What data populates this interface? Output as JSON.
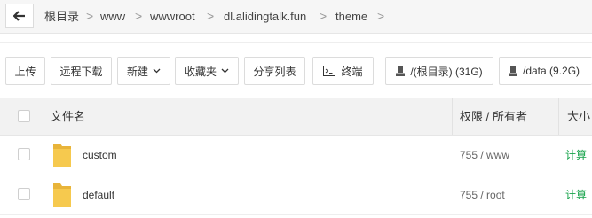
{
  "breadcrumb": {
    "items": [
      "根目录",
      "www",
      "wwwroot",
      "dl.alidingtalk.fun",
      "theme"
    ],
    "separator": ">"
  },
  "toolbar": {
    "upload": "上传",
    "remote_download": "远程下载",
    "new": "新建",
    "favorites": "收藏夹",
    "share_list": "分享列表",
    "terminal": "终端",
    "disk_root": "/(根目录) (31G)",
    "disk_data": "/data (9.2G)"
  },
  "table": {
    "headers": {
      "name": "文件名",
      "permission": "权限 / 所有者",
      "size": "大小"
    },
    "rows": [
      {
        "name": "custom",
        "permission": "755 / www",
        "size_action": "计算"
      },
      {
        "name": "default",
        "permission": "755 / root",
        "size_action": "计算"
      }
    ]
  },
  "colors": {
    "folder": "#f4c542",
    "calc_link": "#16a34a",
    "header_bg": "#f2f2f2"
  },
  "icons": [
    "back-arrow-icon",
    "chevron-right-icon",
    "chevron-down-icon",
    "terminal-icon",
    "disk-icon",
    "folder-icon"
  ]
}
